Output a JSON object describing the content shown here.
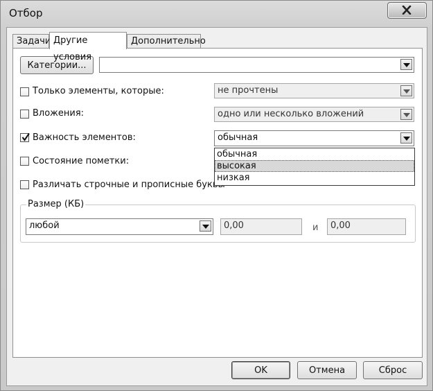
{
  "window": {
    "title": "Отбор",
    "close_icon": "close-icon"
  },
  "tabs": [
    {
      "label": "Задачи",
      "active": false
    },
    {
      "label": "Другие условия",
      "active": true
    },
    {
      "label": "Дополнительно",
      "active": false
    }
  ],
  "categories": {
    "button_label": "Категории...",
    "value": ""
  },
  "conditions": [
    {
      "label": "Только элементы, которые:",
      "checked": false,
      "value": "не прочтены"
    },
    {
      "label": "Вложения:",
      "checked": false,
      "value": "одно или несколько вложений"
    },
    {
      "label": "Важность элементов:",
      "checked": true,
      "value": "обычная"
    },
    {
      "label": "Состояние пометки:",
      "checked": false
    },
    {
      "label": "Различать строчные и прописные буквы",
      "checked": false
    }
  ],
  "importance_options": {
    "items": [
      "обычная",
      "высокая",
      "низкая"
    ],
    "highlighted": "высокая"
  },
  "size": {
    "group_label": "Размер (КБ)",
    "mode": "любой",
    "from": "0,00",
    "and_label": "и",
    "to": "0,00"
  },
  "footer": {
    "ok_label": "OK",
    "cancel_label": "Отмена",
    "reset_label": "Сброс"
  }
}
